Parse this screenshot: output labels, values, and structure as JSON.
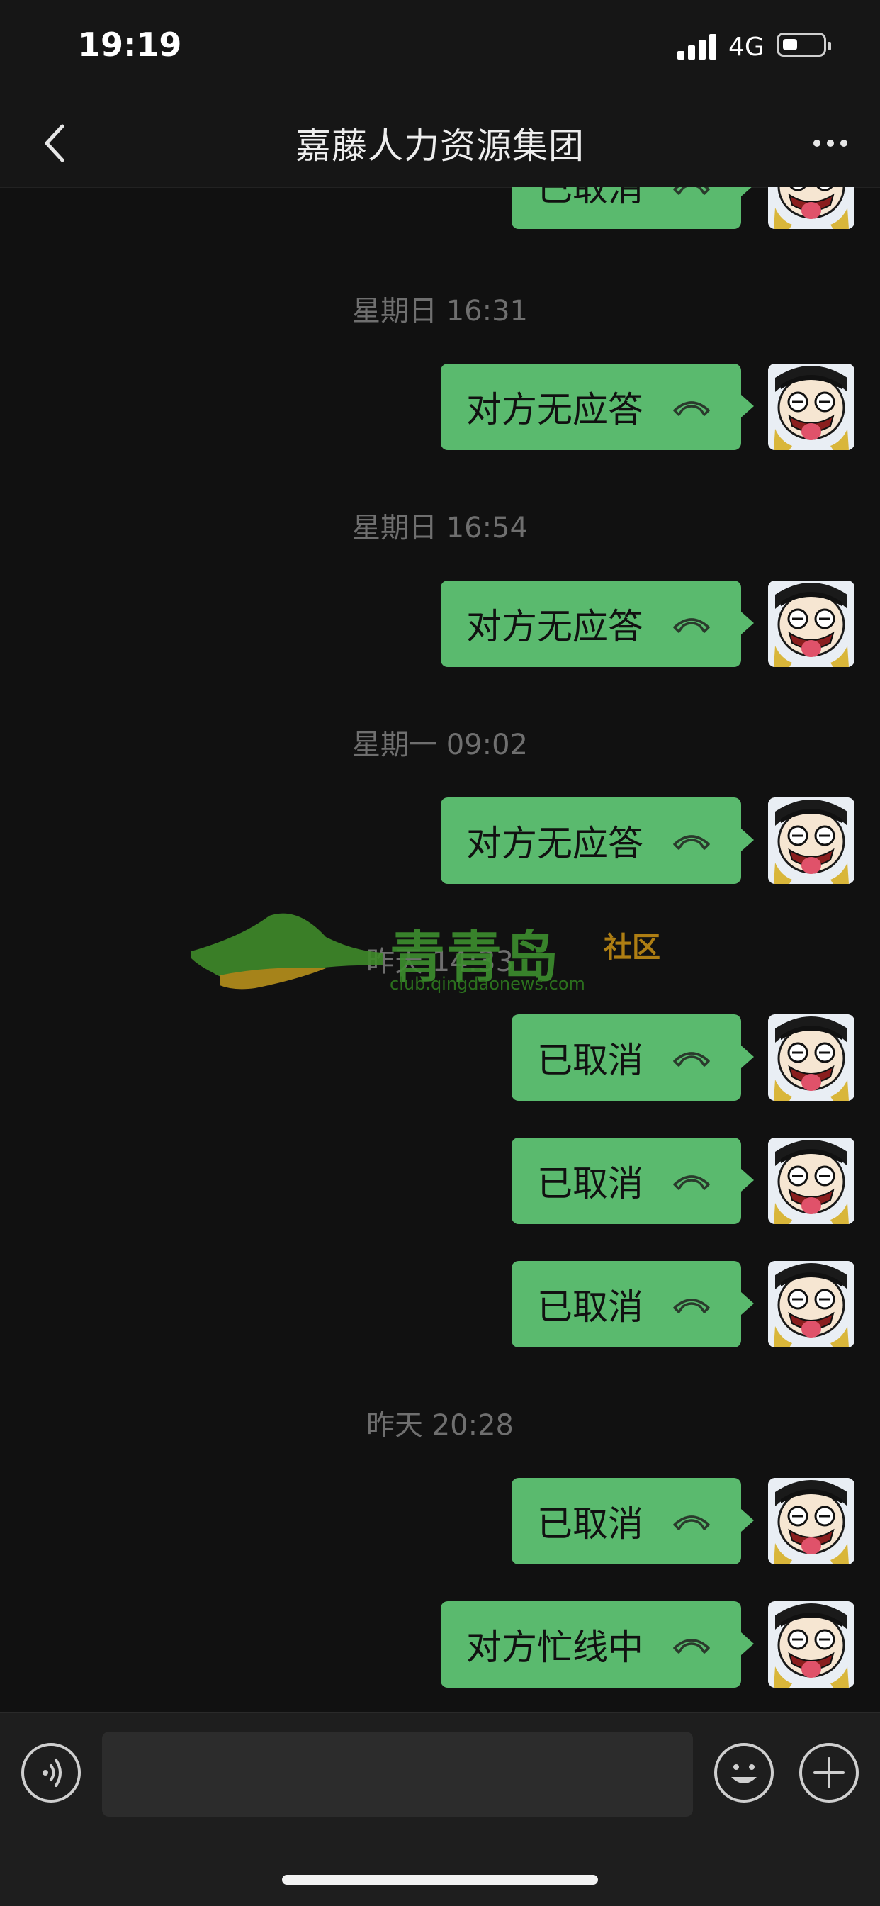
{
  "status_bar": {
    "time": "19:19",
    "network": "4G",
    "battery_icon": "battery-icon",
    "signal_icon": "signal-bars-icon"
  },
  "header": {
    "title": "嘉藤人力资源集团",
    "back_icon": "chevron-left-icon",
    "more_icon": "more-dots-icon"
  },
  "messages": [
    {
      "type": "call",
      "label": "已取消",
      "icon": "phone-hangup-icon"
    },
    {
      "type": "time",
      "label": "星期日 16:31"
    },
    {
      "type": "call",
      "label": "对方无应答",
      "icon": "phone-hangup-icon"
    },
    {
      "type": "time",
      "label": "星期日 16:54"
    },
    {
      "type": "call",
      "label": "对方无应答",
      "icon": "phone-hangup-icon"
    },
    {
      "type": "time",
      "label": "星期一 09:02"
    },
    {
      "type": "call",
      "label": "对方无应答",
      "icon": "phone-hangup-icon"
    },
    {
      "type": "time",
      "label": "昨天 14:33"
    },
    {
      "type": "call",
      "label": "已取消",
      "icon": "phone-hangup-icon"
    },
    {
      "type": "call",
      "label": "已取消",
      "icon": "phone-hangup-icon"
    },
    {
      "type": "call",
      "label": "已取消",
      "icon": "phone-hangup-icon"
    },
    {
      "type": "time",
      "label": "昨天 20:28"
    },
    {
      "type": "call",
      "label": "已取消",
      "icon": "phone-hangup-icon"
    },
    {
      "type": "call",
      "label": "对方忙线中",
      "icon": "phone-hangup-icon"
    }
  ],
  "watermark": {
    "title": "青青岛",
    "subtitle": "社区",
    "url": "club.qingdaonews.com"
  },
  "input_bar": {
    "voice_icon": "voice-icon",
    "input_value": "",
    "emoji_icon": "emoji-icon",
    "plus_icon": "plus-icon"
  },
  "colors": {
    "background": "#111111",
    "bubble": "#5aba6e",
    "timestamp": "#6f6f6f"
  }
}
